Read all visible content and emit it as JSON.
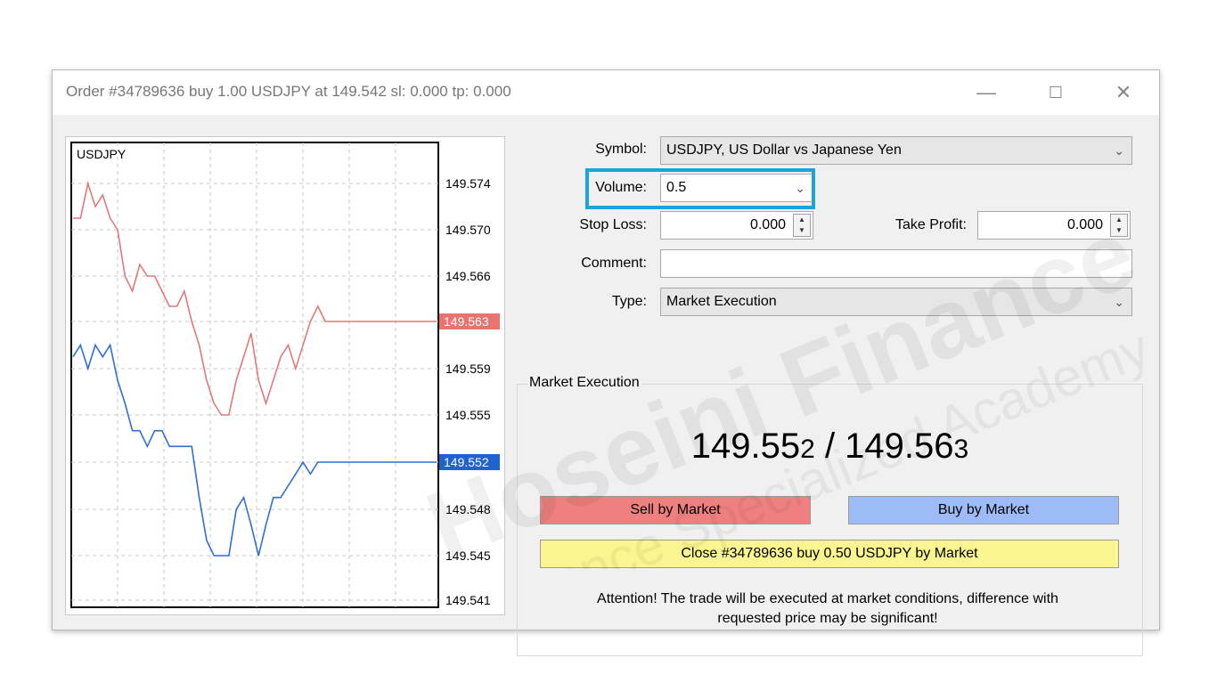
{
  "window": {
    "title": "Order #34789636 buy 1.00 USDJPY at 149.542 sl: 0.000 tp: 0.000",
    "buttons": {
      "minimize": "—",
      "maximize": "☐",
      "close": "✕"
    }
  },
  "chart": {
    "symbol": "USDJPY",
    "ask_tag": "149.563",
    "bid_tag": "149.552",
    "ticks": [
      "149.574",
      "149.570",
      "149.566",
      "149.563",
      "149.559",
      "149.555",
      "149.552",
      "149.548",
      "149.545",
      "149.541"
    ],
    "colors": {
      "ask": "#e07a78",
      "bid": "#2f6fd1",
      "ask_tag_bg": "#e8736f",
      "bid_tag_bg": "#1e63d0"
    }
  },
  "chart_data": {
    "type": "line",
    "ylim": [
      149.541,
      149.574
    ],
    "series": [
      {
        "values": [
          149.571,
          149.571,
          149.574,
          149.572,
          149.573,
          149.571,
          149.57,
          149.566,
          149.565,
          149.567,
          149.566,
          149.566,
          149.565,
          149.564,
          149.564,
          149.565,
          149.563,
          149.561,
          149.558,
          149.556,
          149.555,
          149.555,
          149.558,
          149.56,
          149.562,
          149.558,
          149.556,
          149.558,
          149.56,
          149.561,
          149.559,
          149.561,
          149.563,
          149.564,
          149.563,
          149.563,
          149.563,
          149.563,
          149.563,
          149.563,
          149.563,
          149.563,
          149.563,
          149.563,
          149.563,
          149.563,
          149.563,
          149.563,
          149.563,
          149.563
        ]
      },
      {
        "values": [
          149.56,
          149.561,
          149.559,
          149.561,
          149.56,
          149.561,
          149.558,
          149.556,
          149.554,
          149.554,
          149.553,
          149.554,
          149.554,
          149.553,
          149.553,
          149.553,
          149.553,
          149.549,
          149.546,
          149.545,
          149.545,
          149.545,
          149.548,
          149.549,
          149.547,
          149.545,
          149.547,
          149.549,
          149.549,
          149.55,
          149.551,
          149.552,
          149.551,
          149.552,
          149.552,
          149.552,
          149.552,
          149.552,
          149.552,
          149.552,
          149.552,
          149.552,
          149.552,
          149.552,
          149.552,
          149.552,
          149.552,
          149.552,
          149.552,
          149.552
        ]
      }
    ]
  },
  "form": {
    "symbol_label": "Symbol:",
    "symbol_value": "USDJPY, US Dollar vs Japanese Yen",
    "volume_label": "Volume:",
    "volume_value": "0.5",
    "stop_loss_label": "Stop Loss:",
    "stop_loss_value": "0.000",
    "take_profit_label": "Take Profit:",
    "take_profit_value": "0.000",
    "comment_label": "Comment:",
    "comment_value": "",
    "type_label": "Type:",
    "type_value": "Market Execution"
  },
  "execution": {
    "group_title": "Market Execution",
    "bid_main": "149.55",
    "bid_small": "2",
    "separator": " / ",
    "ask_main": "149.56",
    "ask_small": "3",
    "sell_button": "Sell by Market",
    "buy_button": "Buy by Market",
    "close_button": "Close #34789636 buy 0.50 USDJPY by Market",
    "attention_line1": "Attention! The trade will be executed at market conditions, difference with",
    "attention_line2": "requested price may be significant!",
    "colors": {
      "sell": "#f08080",
      "buy": "#9dbbf6",
      "close": "#fbf58f",
      "highlight": "#1ca3d9"
    }
  },
  "watermark": {
    "line1": "Hoseini Finance",
    "line2": "Finance Specialized Academy"
  }
}
